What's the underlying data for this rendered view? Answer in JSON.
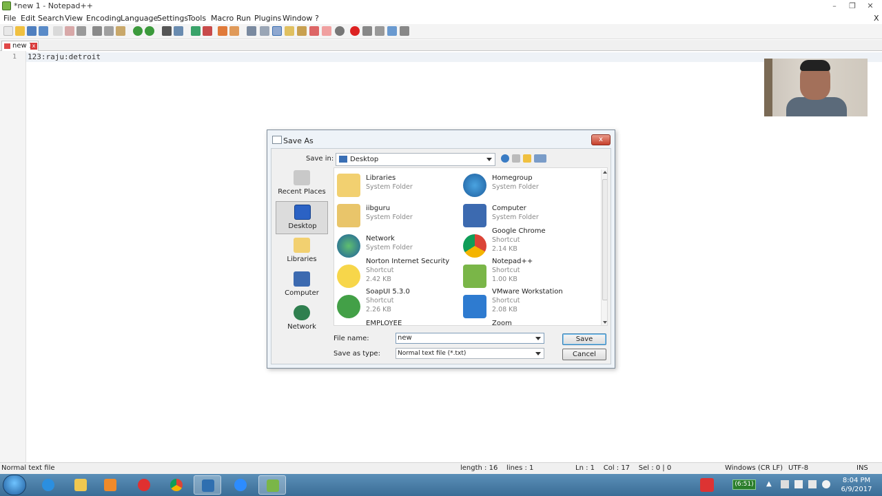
{
  "app": {
    "window_title": "*new 1 - Notepad++",
    "close_x": "X"
  },
  "menu": [
    "File",
    "Edit",
    "Search",
    "View",
    "Encoding",
    "Language",
    "Settings",
    "Tools",
    "Macro",
    "Run",
    "Plugins",
    "Window",
    "?"
  ],
  "tabs": [
    {
      "label": "new 1",
      "close": "x"
    }
  ],
  "editor": {
    "line_numbers": [
      "1"
    ],
    "lines": [
      "123:raju:detroit"
    ]
  },
  "statusbar": {
    "file_type": "Normal text file",
    "length_lines": "length : 16    lines : 1",
    "position": "Ln : 1    Col : 17    Sel : 0 | 0",
    "eol": "Windows (CR LF)",
    "encoding": "UTF-8",
    "mode": "INS"
  },
  "dialog": {
    "title": "Save As",
    "close": "x",
    "save_in_label": "Save in:",
    "save_in_value": "Desktop",
    "places": [
      "Recent Places",
      "Desktop",
      "Libraries",
      "Computer",
      "Network"
    ],
    "files": [
      {
        "name": "Libraries",
        "type": "System Folder",
        "size": ""
      },
      {
        "name": "Homegroup",
        "type": "System Folder",
        "size": ""
      },
      {
        "name": "iibguru",
        "type": "System Folder",
        "size": ""
      },
      {
        "name": "Computer",
        "type": "System Folder",
        "size": ""
      },
      {
        "name": "Network",
        "type": "System Folder",
        "size": ""
      },
      {
        "name": "Google Chrome",
        "type": "Shortcut",
        "size": "2.14 KB"
      },
      {
        "name": "Norton Internet Security",
        "type": "Shortcut",
        "size": "2.42 KB"
      },
      {
        "name": "Notepad++",
        "type": "Shortcut",
        "size": "1.00 KB"
      },
      {
        "name": "SoapUI 5.3.0",
        "type": "Shortcut",
        "size": "2.26 KB"
      },
      {
        "name": "VMware Workstation",
        "type": "Shortcut",
        "size": "2.08 KB"
      },
      {
        "name": "EMPLOYEE",
        "type": "",
        "size": ""
      },
      {
        "name": "Zoom",
        "type": "",
        "size": ""
      }
    ],
    "file_name_label": "File name:",
    "file_name_value": "new",
    "save_as_type_label": "Save as type:",
    "save_as_type_value": "Normal text file (*.txt)",
    "save_button": "Save",
    "cancel_button": "Cancel"
  },
  "taskbar": {
    "battery": "(6:51)",
    "time": "8:04 PM",
    "date": "6/9/2017"
  }
}
